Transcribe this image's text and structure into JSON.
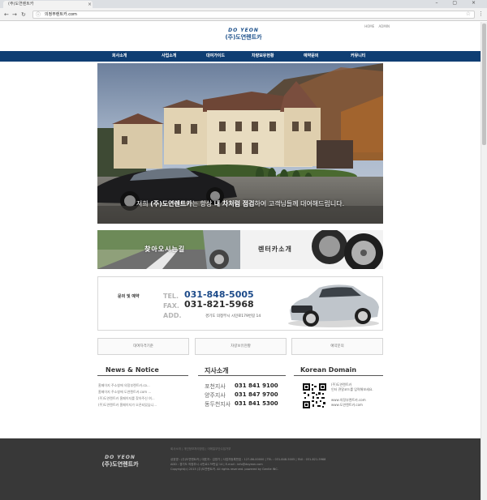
{
  "browser": {
    "tab_title": "(주)도연렌트카",
    "address": "의정부렌트카.com",
    "close_glyph": "×",
    "window_controls": "– ▢ ×"
  },
  "header": {
    "top_links": [
      "HOME",
      "ADMIN"
    ],
    "logo_mark": "DO YEON",
    "logo_text": "(주)도연렌트카"
  },
  "nav": {
    "items": [
      "회사소개",
      "사업소개",
      "대여가이드",
      "차량보유현황",
      "예약문의",
      "커뮤니티"
    ]
  },
  "hero": {
    "caption_pre": "저희 ",
    "caption_brand": "(주)도연렌트카",
    "caption_mid": "는 항상 ",
    "caption_strong": "내 차처럼 점검",
    "caption_post": "하여 고객님들께 대여해드립니다."
  },
  "banners": {
    "left_label": "찾아오시는길",
    "right_label": "렌터카소개"
  },
  "contact": {
    "title": "문의 및 예약",
    "tel_label": "TEL.",
    "tel": "031-848-5005",
    "fax_label": "FAX.",
    "fax": "031-821-5968",
    "addr_label": "ADD.",
    "address": "경기도 의정부시 시민로179번길 14"
  },
  "quick_buttons": [
    "대여자격기준",
    "차량보유현황",
    "예약문의"
  ],
  "news": {
    "title": "News & Notice",
    "items": [
      "홈페이지 주소창에 의정부렌트카.co...",
      "홈페이지 주소창에 도연렌트카.com ...",
      "(주)도연렌트카 홈페이지를 찾아주신 여...",
      "(주)도연렌트카 홈페이지가 오픈되었습니..."
    ]
  },
  "branches": {
    "title": "지사소개",
    "items": [
      {
        "name": "포천지사",
        "phone": "031 841 9100"
      },
      {
        "name": "양주지사",
        "phone": "031 847 9700"
      },
      {
        "name": "동두천지사",
        "phone": "031 841 5300"
      }
    ]
  },
  "domain": {
    "title": "Korean Domain",
    "lines": [
      "(주)도연렌트카",
      "인터 큐알코드를 입력해보세요.",
      "",
      "www.의정부렌트카.com",
      "www.도연렌트카.com"
    ]
  },
  "footer": {
    "logo_mark": "DO YEON",
    "logo_text": "(주)도연렌트카",
    "links": "회사소개 | 개인정보처리방침 | 이메일무단수집거부",
    "lines": [
      "상호명 : (주)도연렌트카 | 대표자 : 김영기 | 사업자등록번호 : 127-86-00000 | TEL : 031-848-5005 | FAX : 031-821-5968",
      "ADD : 경기도 의정부시 시민로179번길 14 | E-mail : info@doyeon.com",
      "Copyright(c) 2015 (주)도연렌트카. All rights reserved. powered by Gentle INC."
    ]
  },
  "colors": {
    "nav_bg": "#0f3e73",
    "brand": "#1b4f8a",
    "footer_bg": "#383838",
    "phone_blue": "#1d4b8a",
    "phone_dark": "#2b2b2b"
  }
}
